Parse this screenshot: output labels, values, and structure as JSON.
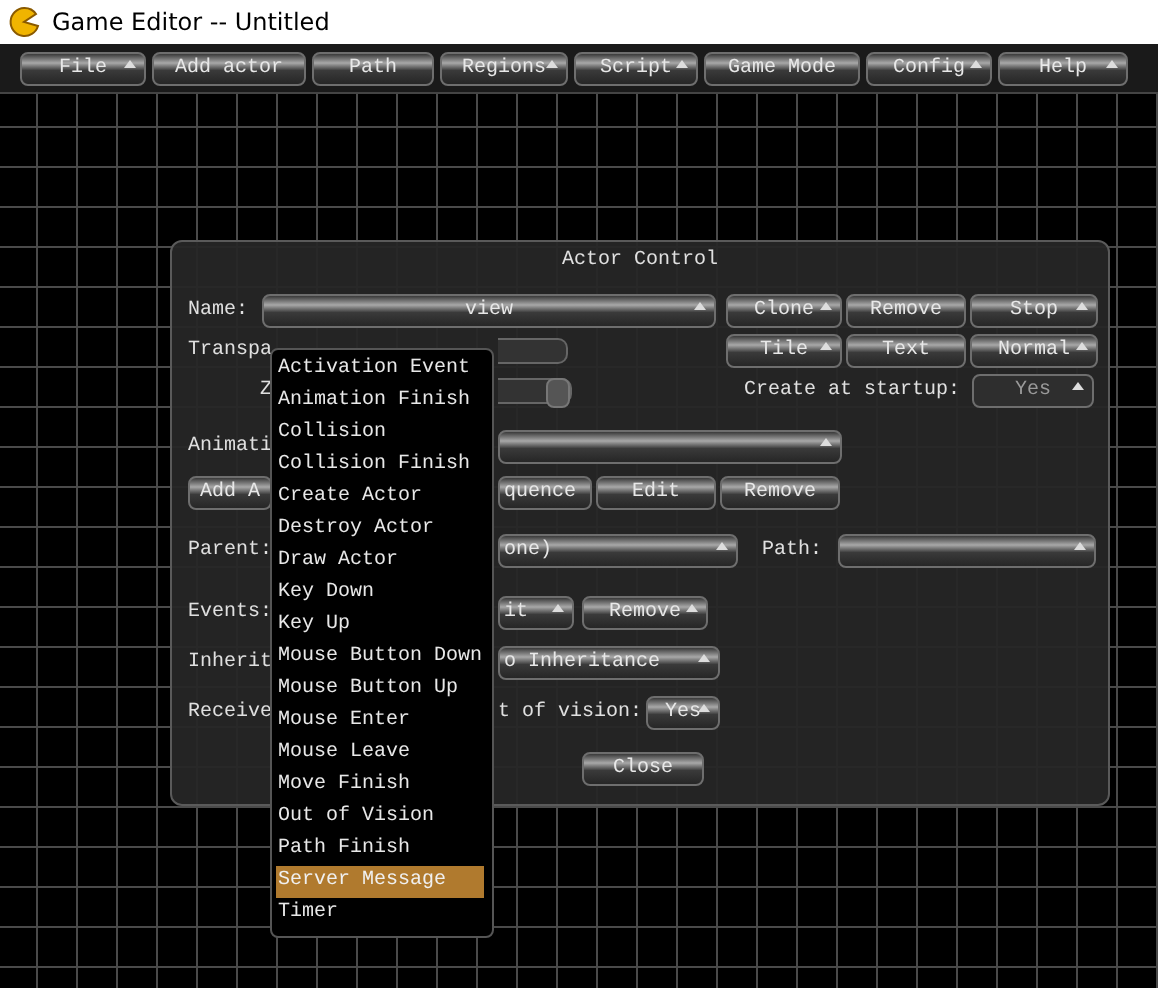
{
  "window": {
    "title": "Game Editor -- Untitled"
  },
  "menu": [
    {
      "label": "File",
      "caret": true
    },
    {
      "label": "Add actor",
      "caret": false
    },
    {
      "label": "Path",
      "caret": false
    },
    {
      "label": "Regions",
      "caret": true
    },
    {
      "label": "Script",
      "caret": true
    },
    {
      "label": "Game Mode",
      "caret": false
    },
    {
      "label": "Config",
      "caret": true
    },
    {
      "label": "Help",
      "caret": true
    }
  ],
  "dialog": {
    "title": "Actor Control",
    "name": {
      "label": "Name:",
      "value": "view"
    },
    "actor_buttons": [
      {
        "label": "Clone",
        "caret": true
      },
      {
        "label": "Remove",
        "caret": false
      },
      {
        "label": "Stop",
        "caret": true
      }
    ],
    "mode_buttons": [
      {
        "label": "Tile",
        "caret": true
      },
      {
        "label": "Text",
        "caret": false
      },
      {
        "label": "Normal",
        "caret": true
      }
    ],
    "transparency_label": "Transpa",
    "z_label": "Z",
    "create_at_startup": {
      "label": "Create at startup:",
      "value": "Yes",
      "disabled": true
    },
    "animation_label": "Animati",
    "animation_buttons": [
      {
        "label": "Add A"
      },
      {
        "label": "quence"
      },
      {
        "label": "Edit"
      },
      {
        "label": "Remove"
      }
    ],
    "parent": {
      "label": "Parent:",
      "value": "one)"
    },
    "path": {
      "label": "Path:"
    },
    "events": {
      "label": "Events:",
      "buttons": [
        {
          "label": "it",
          "caret": true
        },
        {
          "label": "Remove",
          "caret": true
        }
      ]
    },
    "inherit": {
      "label": "Inherit",
      "value": "o Inheritance"
    },
    "receive": {
      "label": "Receive",
      "text": "t of vision:",
      "value": "Yes"
    },
    "close": "Close"
  },
  "popup": {
    "items": [
      {
        "label": "Activation Event",
        "selected": false
      },
      {
        "label": "Animation Finish",
        "selected": false
      },
      {
        "label": "Collision",
        "selected": false
      },
      {
        "label": "Collision Finish",
        "selected": false
      },
      {
        "label": "Create Actor",
        "selected": false
      },
      {
        "label": "Destroy Actor",
        "selected": false
      },
      {
        "label": "Draw Actor",
        "selected": false
      },
      {
        "label": "Key Down",
        "selected": false
      },
      {
        "label": "Key Up",
        "selected": false
      },
      {
        "label": "Mouse Button Down",
        "selected": false
      },
      {
        "label": "Mouse Button Up",
        "selected": false
      },
      {
        "label": "Mouse Enter",
        "selected": false
      },
      {
        "label": "Mouse Leave",
        "selected": false
      },
      {
        "label": "Move Finish",
        "selected": false
      },
      {
        "label": "Out of Vision",
        "selected": false
      },
      {
        "label": "Path Finish",
        "selected": false
      },
      {
        "label": "Server Message",
        "selected": true
      },
      {
        "label": "Timer",
        "selected": false
      }
    ]
  }
}
